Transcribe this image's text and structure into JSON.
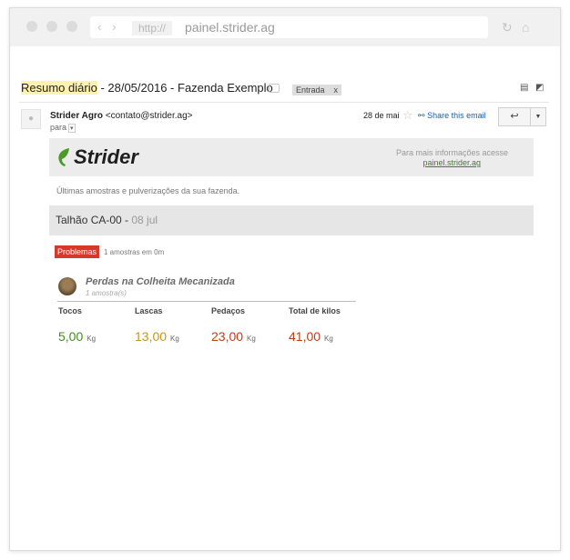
{
  "browser": {
    "protocol": "http://",
    "url": "painel.strider.ag"
  },
  "email": {
    "subject_highlight": "Resumo diário",
    "subject_rest": " - 28/05/2016 - Fazenda Exemplo",
    "tag_label": "Entrada",
    "tag_close": "x",
    "sender_name": "Strider Agro",
    "sender_email": "<contato@strider.ag>",
    "to_label": "para",
    "date": "28 de mai",
    "share_label": "Share this email"
  },
  "body": {
    "brand_name": "Strider",
    "info_text": "Para mais informações acesse",
    "info_link": "painel.strider.ag",
    "intro": "Últimas amostras e pulverizações da sua fazenda.",
    "plot_name": "Talhão CA-00 - ",
    "plot_date": "08 jul",
    "badge": "Problemas",
    "badge_note": "1 amostras em 0m",
    "sample_title": "Perdas na Colheita Mecanizada",
    "sample_sub": "1 amostra(s)",
    "metrics": [
      {
        "label": "Tocos",
        "value": "5,00",
        "unit": "Kg",
        "color": "#3f8f1f"
      },
      {
        "label": "Lascas",
        "value": "13,00",
        "unit": "Kg",
        "color": "#c8961a"
      },
      {
        "label": "Pedaços",
        "value": "23,00",
        "unit": "Kg",
        "color": "#c83a14"
      },
      {
        "label": "Total de kilos",
        "value": "41,00",
        "unit": "Kg",
        "color": "#c83a14"
      }
    ]
  },
  "icons": [
    "arrow-left-icon",
    "arrow-right-icon",
    "reload-icon",
    "home-icon",
    "label-icon",
    "print-icon",
    "new-window-icon",
    "person-icon",
    "star-icon",
    "share-icon",
    "reply-icon",
    "chevron-down-icon",
    "leaf-logo-icon"
  ]
}
